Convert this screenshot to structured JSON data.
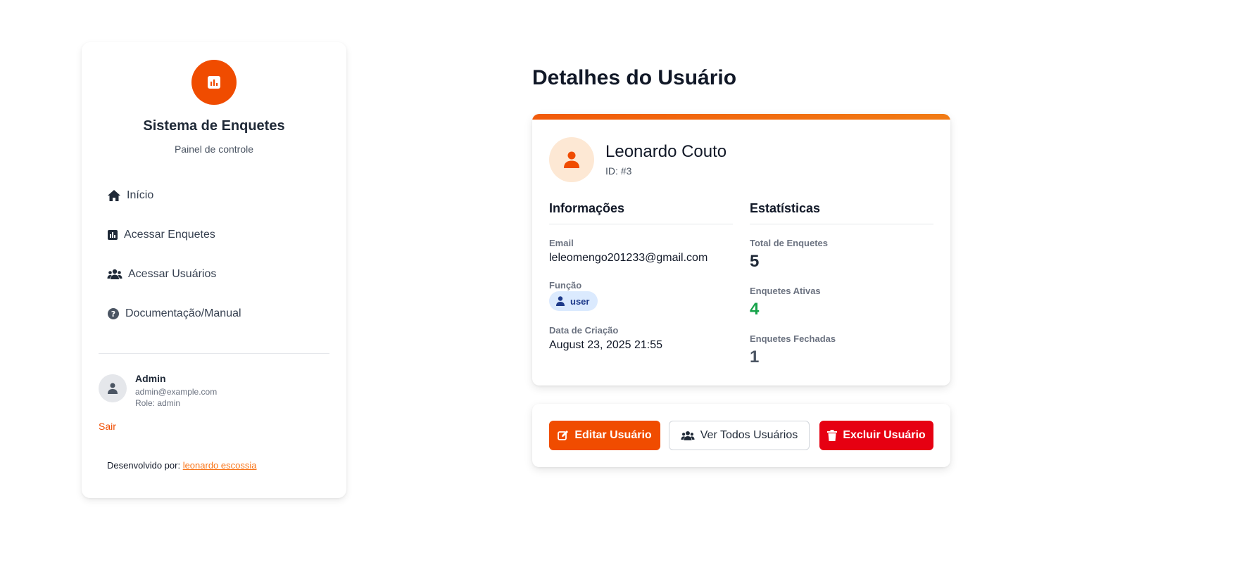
{
  "sidebar": {
    "logo_icon": "chart-square-icon",
    "title": "Sistema de Enquetes",
    "subtitle": "Painel de controle",
    "nav": [
      {
        "label": "Início",
        "icon": "home-icon"
      },
      {
        "label": "Acessar Enquetes",
        "icon": "chart-square-icon"
      },
      {
        "label": "Acessar Usuários",
        "icon": "users-icon"
      },
      {
        "label": "Documentação/Manual",
        "icon": "question-circle-icon"
      }
    ],
    "current_user": {
      "name": "Admin",
      "email": "admin@example.com",
      "role": "Role: admin"
    },
    "logout_label": "Sair",
    "credit_prefix": "Desenvolvido por:",
    "credit_link": "leonardo escossia"
  },
  "main": {
    "title": "Detalhes do Usuário",
    "user": {
      "name": "Leonardo Couto",
      "id": "ID: #3"
    },
    "info": {
      "title": "Informações",
      "email_label": "Email",
      "email_value": "leleomengo201233@gmail.com",
      "role_label": "Função",
      "role_value": "user",
      "created_label": "Data de Criação",
      "created_value": "August 23, 2025 21:55"
    },
    "stats": {
      "title": "Estatísticas",
      "total_label": "Total de Enquetes",
      "total_value": "5",
      "active_label": "Enquetes Ativas",
      "active_value": "4",
      "closed_label": "Enquetes Fechadas",
      "closed_value": "1"
    },
    "actions": {
      "edit_label": "Editar Usuário",
      "all_label": "Ver Todos Usuários",
      "delete_label": "Excluir Usuário"
    }
  },
  "colors": {
    "brand": "#f04c00",
    "danger": "#e60012",
    "success": "#16a34a",
    "badge_bg": "#dbeafe"
  }
}
